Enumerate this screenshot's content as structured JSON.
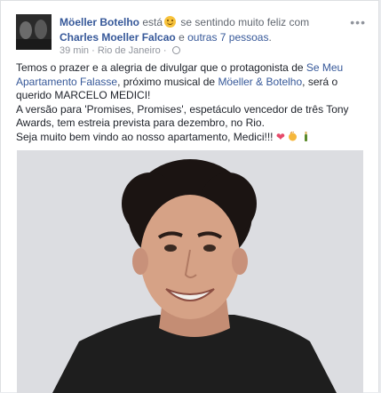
{
  "post": {
    "author": "Möeller Botelho",
    "verb": "está",
    "feeling": "se sentindo muito feliz com",
    "tag1": "Charles Moeller Falcao",
    "conj": "e",
    "others": "outras 7 pessoas",
    "period": ".",
    "time": "39 min",
    "dot": "·",
    "location": "Rio de Janeiro",
    "dot2": "·",
    "more": "•••"
  },
  "text": {
    "l1a": "Temos o prazer e a alegria de divulgar que o protagonista de ",
    "l1link": "Se Meu Apartamento Falasse",
    "l1b": ", próximo musical de ",
    "l1link2": "Möeller & Botelho",
    "l1c": ", será o querido MARCELO MEDICI!",
    "l2": "A versão para 'Promises, Promises', espetáculo vencedor de três Tony Awards, tem estreia prevista para dezembro, no Rio.",
    "l3": "Seja muito bem vindo ao nosso apartamento, Medici!!!"
  },
  "icons": {
    "smile": "smiling-face-icon",
    "globe": "globe-icon",
    "heart": "heart-icon",
    "clap": "clapping-hands-icon",
    "champagne": "champagne-icon"
  },
  "colors": {
    "link": "#365899",
    "meta": "#90949c",
    "text": "#1d2129"
  }
}
